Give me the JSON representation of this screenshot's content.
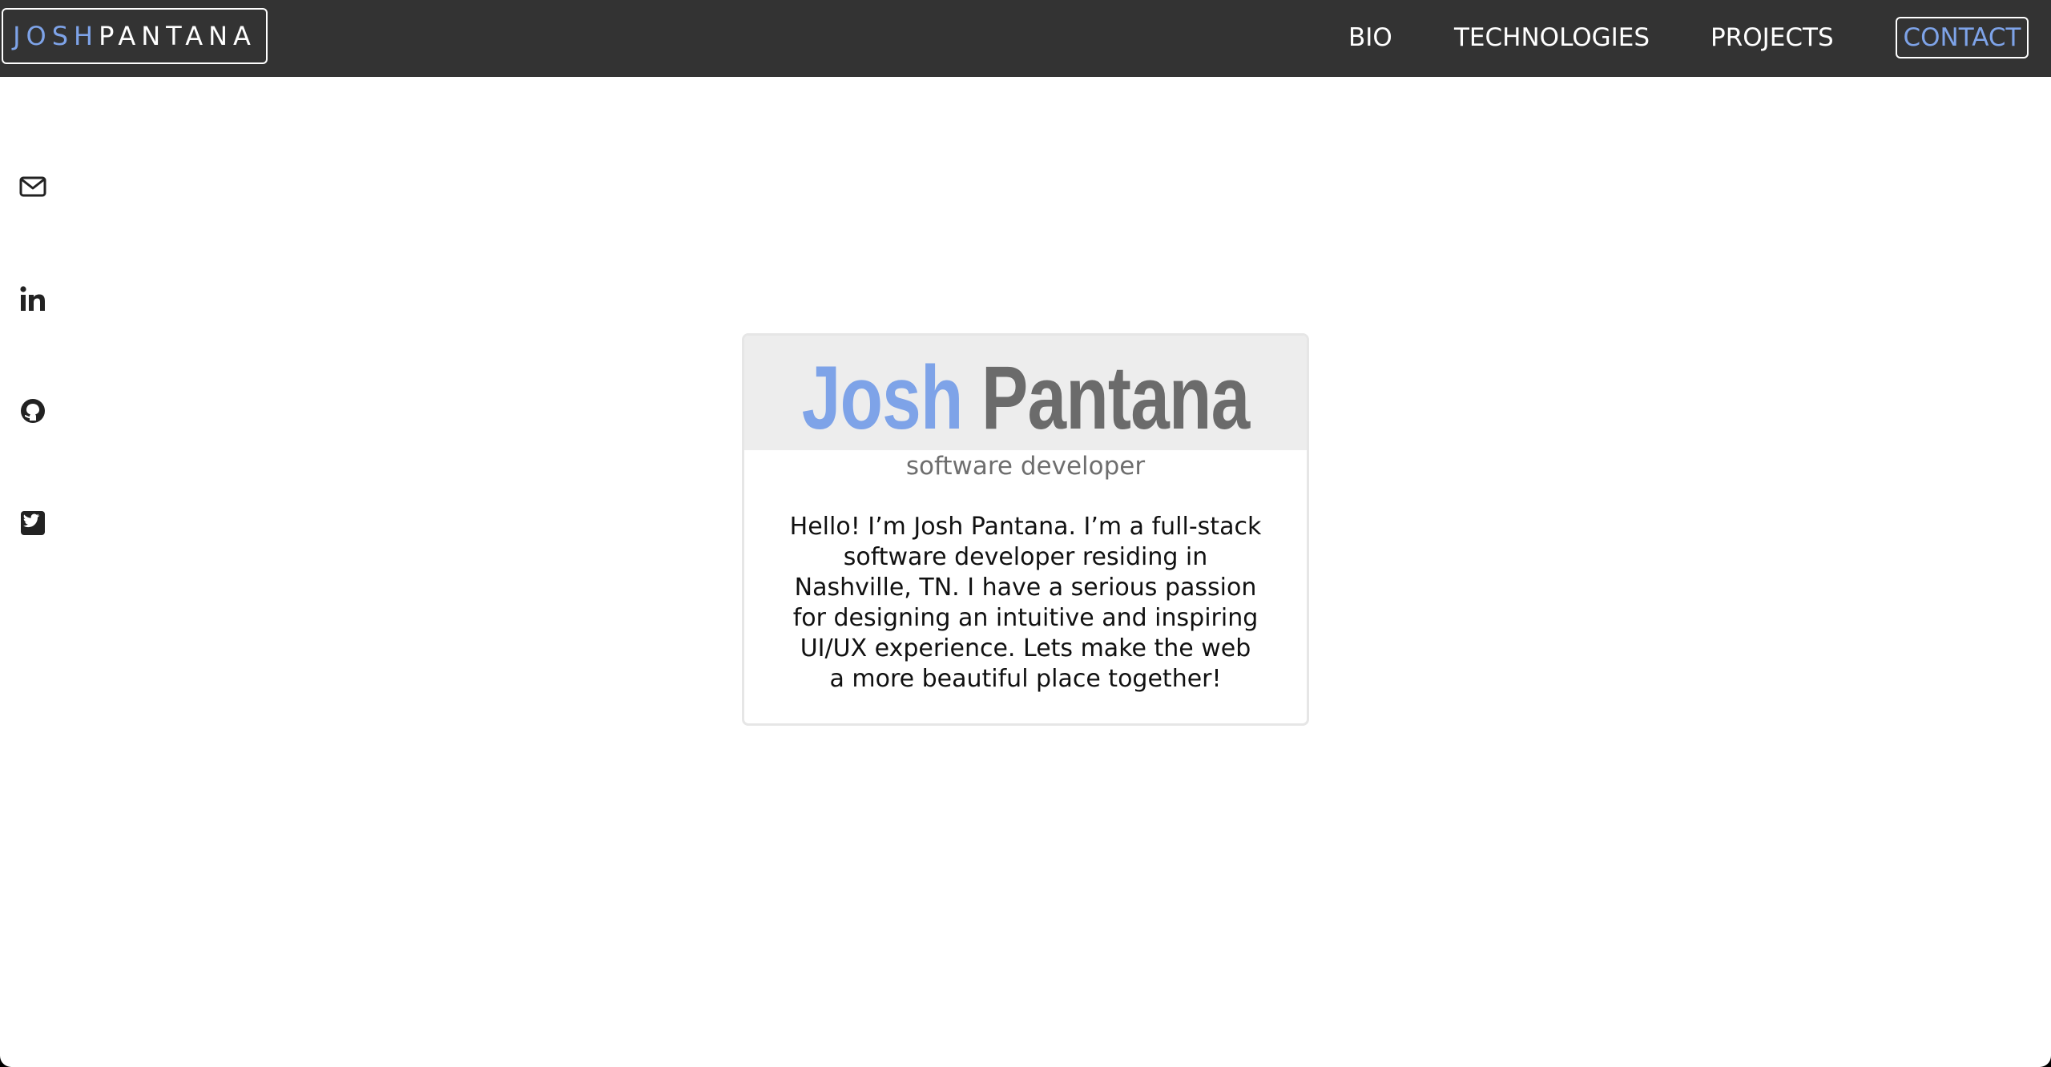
{
  "header": {
    "logo_first": "JOSH",
    "logo_last": "PANTANA",
    "nav": {
      "bio": "BIO",
      "technologies": "TECHNOLOGIES",
      "projects": "PROJECTS",
      "contact": "CONTACT"
    }
  },
  "social": [
    {
      "icon": "envelope-icon"
    },
    {
      "icon": "linkedin-icon"
    },
    {
      "icon": "github-icon"
    },
    {
      "icon": "twitter-icon"
    }
  ],
  "card": {
    "first_name": "Josh",
    "last_name": "Pantana",
    "subtitle": "software developer",
    "bio": "Hello! I’m Josh Pantana. I’m a full-stack software developer residing in Nashville, TN. I have a serious passion for designing an intuitive and inspiring UI/UX experience. Lets make the web a more beautiful place together!"
  },
  "colors": {
    "accent": "#7ea3e8",
    "topbar": "#333333",
    "card_header": "#ededed",
    "name_gray": "#6b6b6b"
  }
}
